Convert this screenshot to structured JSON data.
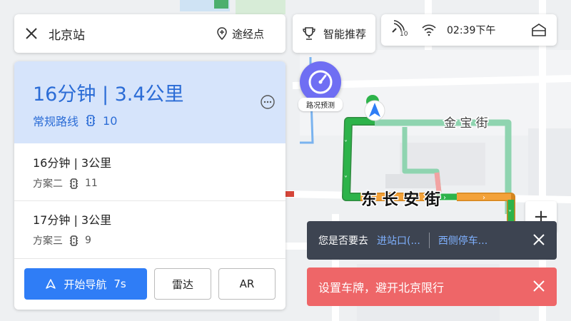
{
  "search": {
    "destination": "北京站",
    "waypoint_label": "途经点"
  },
  "recommend": {
    "label": "智能推荐"
  },
  "status": {
    "signal_badge": "10",
    "time": "02:39下午"
  },
  "routes": {
    "selected": {
      "summary": "16分钟 | 3.4公里",
      "type": "常规路线",
      "lights": "10"
    },
    "alternatives": [
      {
        "summary": "16分钟 | 3公里",
        "name": "方案二",
        "lights": "11"
      },
      {
        "summary": "17分钟 | 3公里",
        "name": "方案三",
        "lights": "9"
      }
    ]
  },
  "actions": {
    "start_nav": "开始导航",
    "start_eta": "7s",
    "radar": "雷达",
    "ar": "AR"
  },
  "map": {
    "speed_label": "路况预测",
    "road_main": "东 长 安 街",
    "road_north": "金  宝  街",
    "zoom_in": "+",
    "colors": {
      "route_green": "#2db34a",
      "route_orange": "#f3a23a",
      "alt_route": "#8fd4b0",
      "accent": "#2f7df6"
    }
  },
  "suggestion": {
    "question": "您是否要去",
    "options": [
      "进站口(...",
      "西侧停车..."
    ]
  },
  "plate_banner": {
    "text": "设置车牌，避开北京限行"
  }
}
